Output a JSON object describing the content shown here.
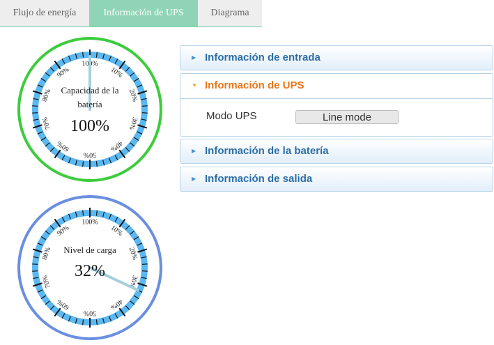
{
  "tabs": [
    {
      "label": "Flujo de energía",
      "active": false
    },
    {
      "label": "Información de UPS",
      "active": true
    },
    {
      "label": "Diagrama",
      "active": false
    }
  ],
  "gauges": [
    {
      "label_line1": "Capacidad de la",
      "label_line2": "batería",
      "value_text": "100%",
      "value": 100,
      "ring_color": "#3ccc3c"
    },
    {
      "label_line1": "Nivel de carga",
      "label_line2": "",
      "value_text": "32%",
      "value": 32,
      "ring_color": "#6b8fe0"
    }
  ],
  "gauge_scale": [
    "100%",
    "10%",
    "20%",
    "30%",
    "40%",
    "50%",
    "60%",
    "70%",
    "80%",
    "90%"
  ],
  "accordion": {
    "input_title": "Información de entrada",
    "ups_title": "Información de UPS",
    "battery_title": "Información de la batería",
    "output_title": "Información de salida"
  },
  "ups_info": {
    "mode_label": "Modo UPS",
    "mode_value": "Line mode"
  }
}
